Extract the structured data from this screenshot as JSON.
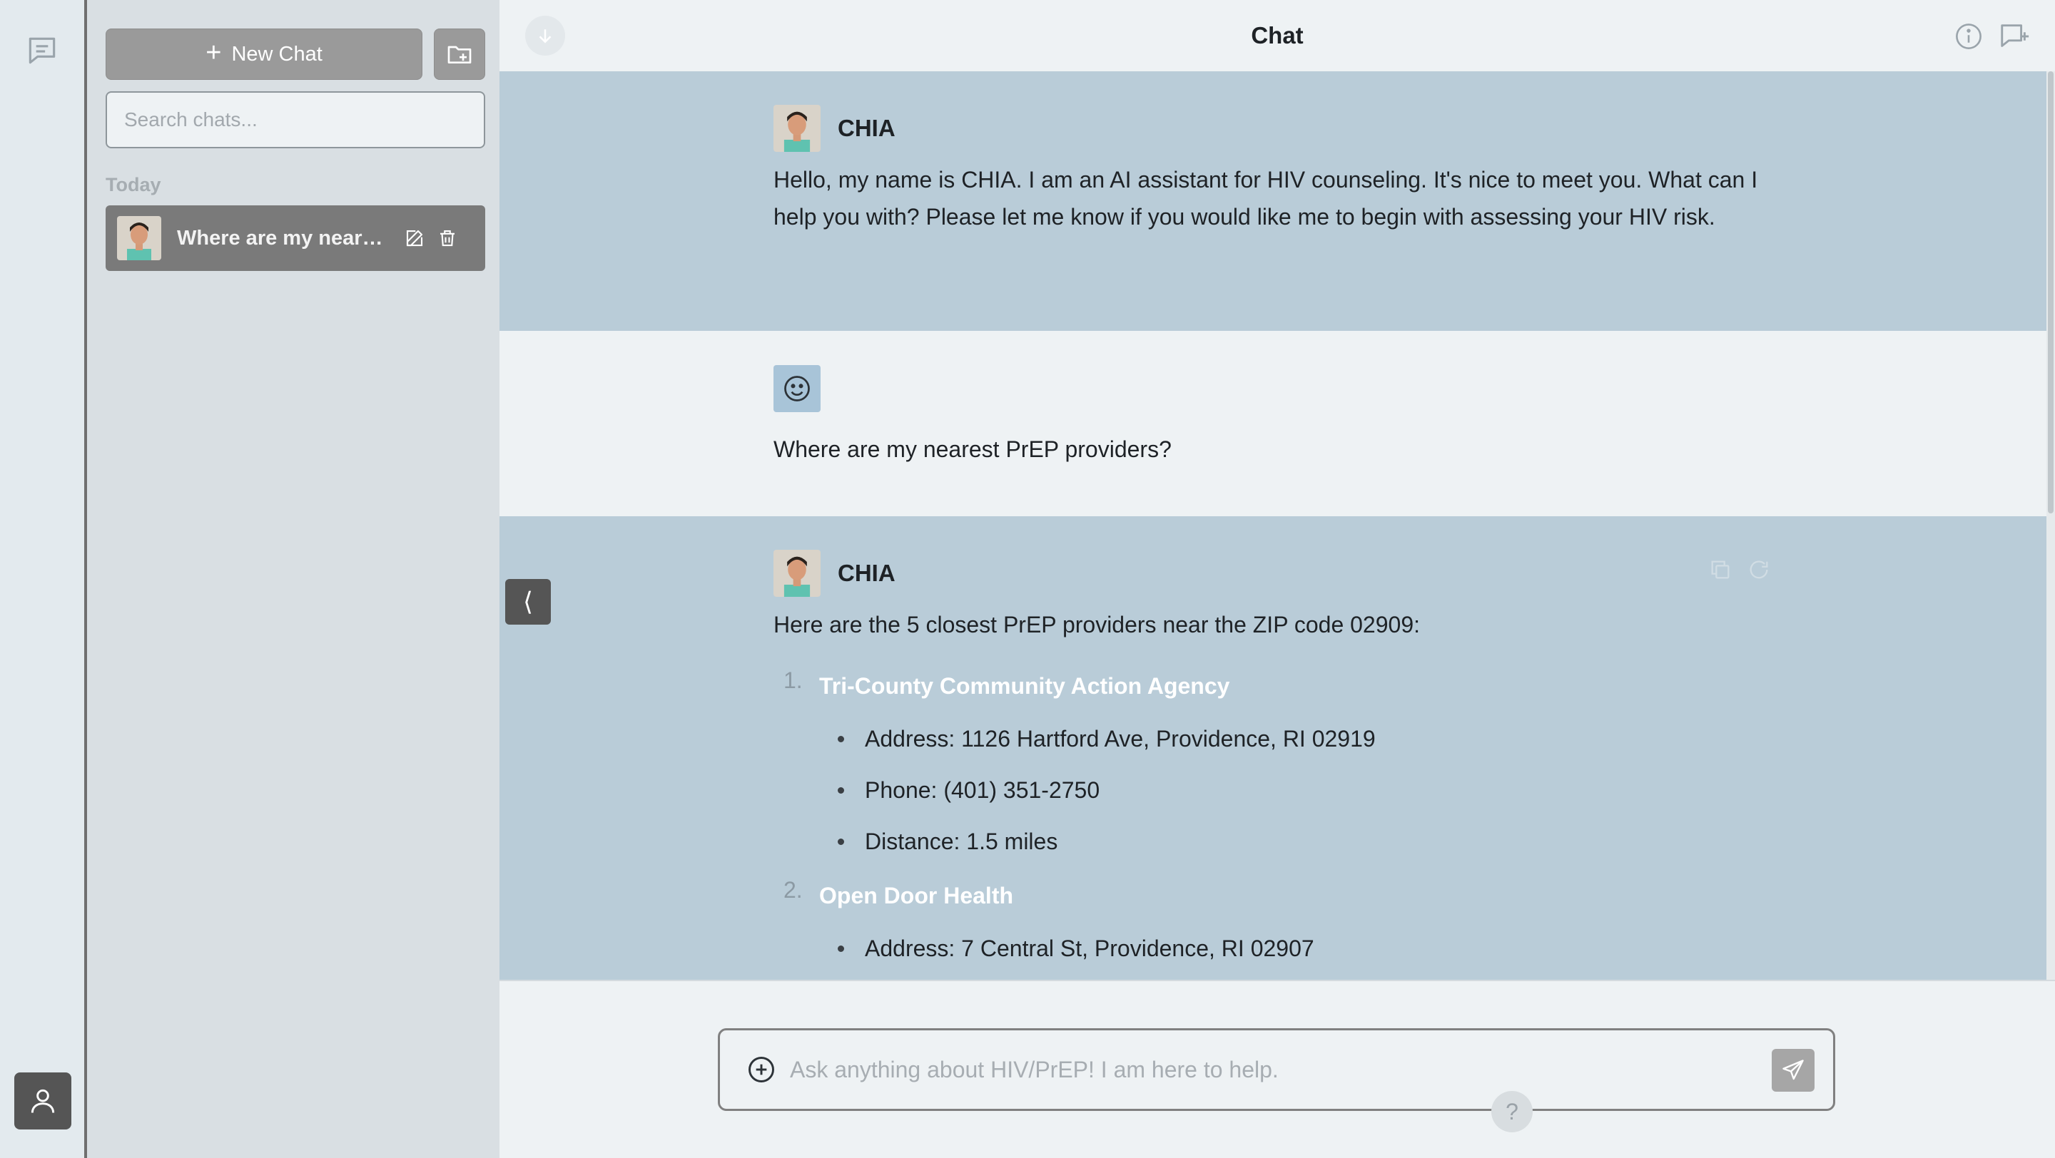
{
  "app": {
    "heading": "Chat",
    "bot_name": "CHIA"
  },
  "sidebar": {
    "new_chat_label": "New Chat",
    "search_placeholder": "Search chats...",
    "section_today": "Today",
    "chats": [
      {
        "title": "Where are my nearest PrEP providers?"
      }
    ]
  },
  "messages": {
    "greeting": {
      "speaker": "CHIA",
      "text": "Hello, my name is CHIA. I am an AI assistant for HIV counseling. It's nice to meet you. What can I help you with? Please let me know if you would like me to begin with assessing your HIV risk."
    },
    "user_question": {
      "text": "Where are my nearest PrEP providers?"
    },
    "answer": {
      "speaker": "CHIA",
      "intro": "Here are the 5 closest PrEP providers near the ZIP code 02909:",
      "providers": [
        {
          "num": "1.",
          "name": "Tri-County Community Action Agency",
          "address": "Address: 1126 Hartford Ave, Providence, RI 02919",
          "phone": "Phone: (401) 351-2750",
          "distance": "Distance: 1.5 miles"
        },
        {
          "num": "2.",
          "name": "Open Door Health",
          "address": "Address: 7 Central St, Providence, RI 02907"
        }
      ]
    }
  },
  "composer": {
    "placeholder": "Ask anything about HIV/PrEP! I am here to help."
  },
  "help_label": "?",
  "icons": {
    "rail": "chat-bubble-icon",
    "user": "user-icon",
    "folder": "folder-plus-icon",
    "edit": "edit-icon",
    "delete": "trash-icon",
    "info": "info-icon",
    "new_chat": "new-chat-icon",
    "scroll_down": "arrow-down-icon",
    "copy": "copy-icon",
    "regenerate": "refresh-icon",
    "attach": "plus-circle-icon",
    "send": "send-icon",
    "collapse": "chevron-left-icon"
  },
  "colors": {
    "bot_bg": "#b9ccd8",
    "user_bg": "#eef2f4",
    "sidebar_bg": "#d9dfe3",
    "rail_bg": "#e3eaee",
    "button_gray": "#9a9a9a",
    "active_chat": "#7a7a7a",
    "provider_name": "#ffffff"
  }
}
